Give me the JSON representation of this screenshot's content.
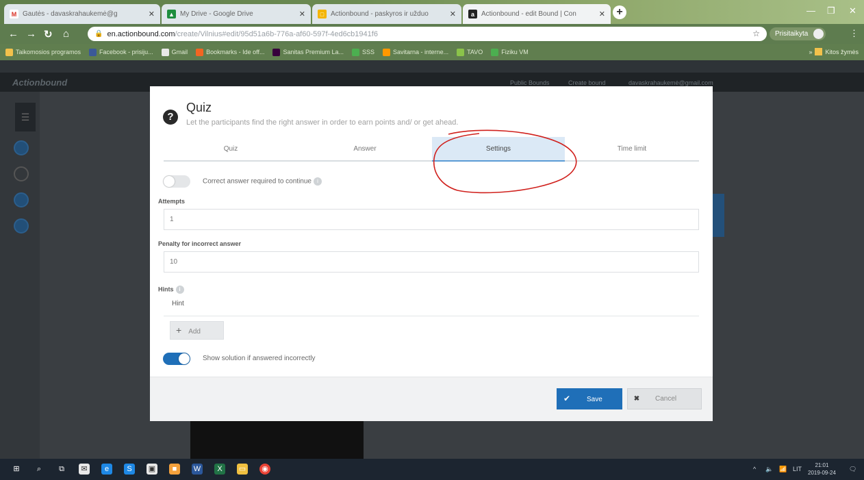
{
  "browser": {
    "tabs": [
      {
        "title": "Gautės - davaskrahaukemė@g",
        "favicon": "gmail-icon",
        "color": "#d93025"
      },
      {
        "title": "My Drive - Google Drive",
        "favicon": "drive-icon",
        "color": "#1e8e3e"
      },
      {
        "title": "Actionbound - paskyros ir užduo",
        "favicon": "actionbound-icon",
        "color": "#f4b400"
      },
      {
        "title": "Actionbound - edit Bound | Con",
        "favicon": "actionbound-dark-icon",
        "color": "#222222"
      }
    ],
    "url_host": "en.actionbound.com",
    "url_path": "/create/Vilnius#edit/95d51a6b-776a-af60-597f-4ed6cb1941f6",
    "profile_name": "Prisitaikyta",
    "bookmarks": [
      "Taikomosios programos",
      "Facebook - prisiju...",
      "Gmail",
      "Bookmarks - Ide off...",
      "Sanitas Premium La...",
      "SSS",
      "Savitarna - interne...",
      "TAVO",
      "Fiziku VM"
    ],
    "other_bookmarks": "Kitos žymės"
  },
  "app": {
    "brand": "Actionbound",
    "header_links": [
      "Public Bounds",
      "Create bound",
      "davaskrahaukemė@gmail.com"
    ]
  },
  "modal": {
    "title": "Quiz",
    "subtitle": "Let the participants find the right answer in order to earn points and/ or get ahead.",
    "tabs": [
      "Quiz",
      "Answer",
      "Settings",
      "Time limit"
    ],
    "active_tab": "Settings",
    "correct_required_label": "Correct answer required to continue",
    "correct_required_on": false,
    "attempts_label": "Attempts",
    "attempts_value": "1",
    "penalty_label": "Penalty for incorrect answer",
    "penalty_value": "10",
    "hints_label": "Hints",
    "hint_item": "Hint",
    "add_label": "Add",
    "show_solution_label": "Show solution if answered incorrectly",
    "show_solution_on": true,
    "save_label": "Save",
    "cancel_label": "Cancel"
  },
  "taskbar": {
    "language": "LIT",
    "time": "21:01",
    "date": "2019-09-24"
  },
  "colors": {
    "accent": "#1f6fb8",
    "annotation": "#d0201c"
  }
}
